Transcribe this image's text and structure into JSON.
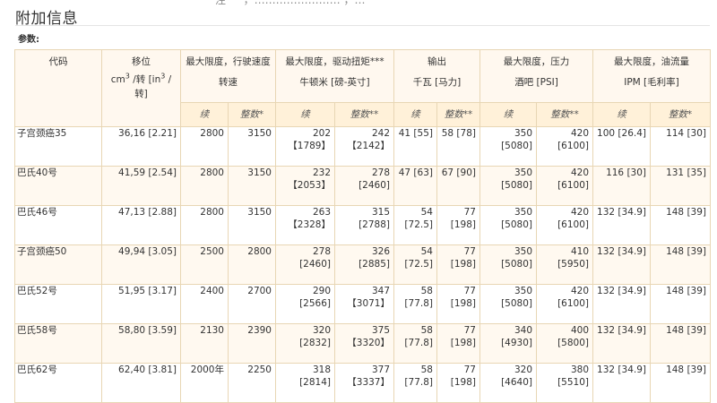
{
  "top_cut_text": "注 一 ，…………………… ，…",
  "section_title": "附加信息",
  "params_label": "参数:",
  "headers": {
    "code": "代码",
    "disp_title": "移位",
    "disp_unit_a": "cm",
    "disp_sup_a": "3",
    "disp_unit_b": " /转 [in",
    "disp_sup_b": "3",
    "disp_unit_c": " /",
    "disp_unit_d": "转]",
    "speed_line1": "最大限度，行驶速度",
    "speed_line2": "转速",
    "torque_line1": "最大限度，驱动扭矩***",
    "torque_line2": "牛顿米 [磅-英寸]",
    "output_line1": "输出",
    "output_line2": "千瓦 [马力]",
    "pressure_line1": "最大限度，压力",
    "pressure_line2": "酒吧 [PSI]",
    "flow_line1": "最大限度，油流量",
    "flow_line2": "IPM [毛利率]"
  },
  "subheaders": [
    "续",
    "整数*",
    "续",
    "整数**",
    "续",
    "整数**",
    "续",
    "整数**",
    "续",
    "整数*"
  ],
  "rows": [
    {
      "code": "子宫颈癌35",
      "disp": "36,16 [2.21]",
      "speed_cont": "2800",
      "speed_int": "3150",
      "torque_cont": "202【1789】",
      "torque_int": "242【2142】",
      "out_cont": "41 [55]",
      "out_int": "58 [78]",
      "press_cont": "350 [5080]",
      "press_int": "420 [6100]",
      "flow_cont": "100 [26.4]",
      "flow_int": "114 [30]"
    },
    {
      "code": "巴氏40号",
      "disp": "41,59 [2.54]",
      "speed_cont": "2800",
      "speed_int": "3150",
      "torque_cont": "232【2053】",
      "torque_int": "278 [2460]",
      "out_cont": "47 [63]",
      "out_int": "67 [90]",
      "press_cont": "350 [5080]",
      "press_int": "420 [6100]",
      "flow_cont": "116 [30]",
      "flow_int": "131 [35]"
    },
    {
      "code": "巴氏46号",
      "disp": "47,13 [2.88]",
      "speed_cont": "2800",
      "speed_int": "3150",
      "torque_cont": "263【2328】",
      "torque_int": "315 [2788]",
      "out_cont": "54 [72.5]",
      "out_int": "77 [198]",
      "press_cont": "350 [5080]",
      "press_int": "420 [6100]",
      "flow_cont": "132 [34.9]",
      "flow_int": "148 [39]"
    },
    {
      "code": "子宫颈癌50",
      "disp": "49,94 [3.05]",
      "speed_cont": "2500",
      "speed_int": "2800",
      "torque_cont": "278 [2460]",
      "torque_int": "326 [2885]",
      "out_cont": "54 [72.5]",
      "out_int": "77 [198]",
      "press_cont": "350 [5080]",
      "press_int": "410 [5950]",
      "flow_cont": "132 [34.9]",
      "flow_int": "148 [39]"
    },
    {
      "code": "巴氏52号",
      "disp": "51,95 [3.17]",
      "speed_cont": "2400",
      "speed_int": "2700",
      "torque_cont": "290 [2566]",
      "torque_int": "347【3071】",
      "out_cont": "58 [77.8]",
      "out_int": "77 [198]",
      "press_cont": "350 [5080]",
      "press_int": "420 [6100]",
      "flow_cont": "132 [34.9]",
      "flow_int": "148 [39]"
    },
    {
      "code": "巴氏58号",
      "disp": "58,80 [3.59]",
      "speed_cont": "2130",
      "speed_int": "2390",
      "torque_cont": "320 [2832]",
      "torque_int": "375【3320】",
      "out_cont": "58 [77.8]",
      "out_int": "77 [198]",
      "press_cont": "340 [4930]",
      "press_int": "400 [5800]",
      "flow_cont": "132 [34.9]",
      "flow_int": "148 [39]"
    },
    {
      "code": "巴氏62号",
      "disp": "62,40 [3.81]",
      "speed_cont": "2000年",
      "speed_int": "2250",
      "torque_cont": "318 [2814]",
      "torque_int": "377【3337】",
      "out_cont": "58 [77.8]",
      "out_int": "77 [198]",
      "press_cont": "320 [4640]",
      "press_int": "380 [5510]",
      "flow_cont": "132 [34.9]",
      "flow_int": "148 [39]"
    }
  ]
}
